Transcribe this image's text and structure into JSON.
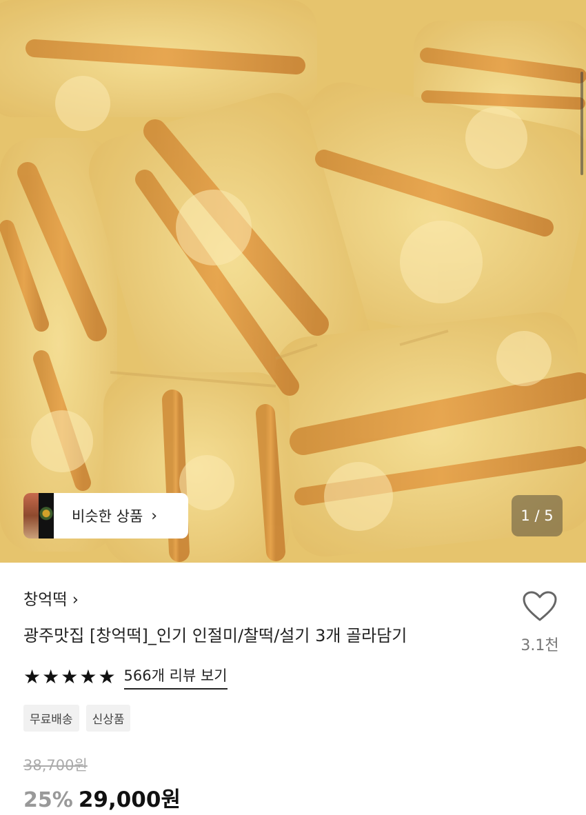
{
  "gallery": {
    "similar_label": "비슷한 상품",
    "similar_chevron": "›",
    "counter": "1 / 5"
  },
  "product": {
    "store": "창억떡 ›",
    "title": "광주맛집 [창억떡]_인기 인절미/찰떡/설기 3개 골라담기",
    "like_count": "3.1천",
    "rating_stars": 5,
    "review_link": "566개 리뷰 보기",
    "tags": [
      "무료배송",
      "신상품"
    ],
    "original_price": "38,700원",
    "discount": "25%",
    "price": "29,000원"
  },
  "colors": {
    "star": "#111111",
    "discount": "#999999"
  }
}
